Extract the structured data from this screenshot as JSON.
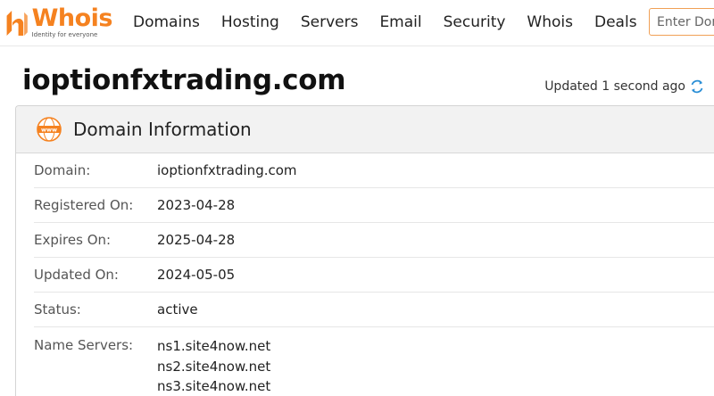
{
  "brand": {
    "name": "Whois",
    "tagline": "Identity for everyone",
    "accent": "#f58220"
  },
  "nav": {
    "items": [
      "Domains",
      "Hosting",
      "Servers",
      "Email",
      "Security",
      "Whois",
      "Deals"
    ]
  },
  "search": {
    "placeholder": "Enter Domain"
  },
  "page": {
    "title": "ioptionfxtrading.com",
    "updated": "Updated 1 second ago"
  },
  "domain_info": {
    "title": "Domain Information",
    "rows": [
      {
        "label": "Domain:",
        "value": "ioptionfxtrading.com"
      },
      {
        "label": "Registered On:",
        "value": "2023-04-28"
      },
      {
        "label": "Expires On:",
        "value": "2025-04-28"
      },
      {
        "label": "Updated On:",
        "value": "2024-05-05"
      },
      {
        "label": "Status:",
        "value": "active"
      }
    ],
    "name_servers": {
      "label": "Name Servers:",
      "values": [
        "ns1.site4now.net",
        "ns2.site4now.net",
        "ns3.site4now.net"
      ]
    }
  }
}
